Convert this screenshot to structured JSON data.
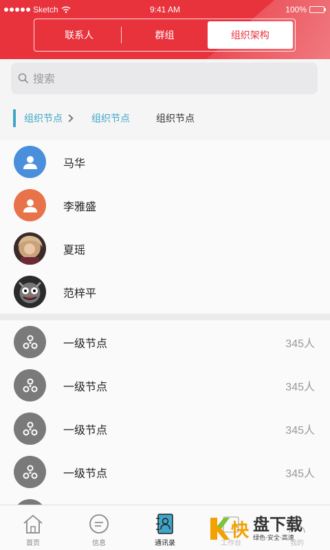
{
  "status_bar": {
    "carrier": "Sketch",
    "time": "9:41 AM",
    "battery": "100%"
  },
  "segments": [
    {
      "label": "联系人",
      "active": false
    },
    {
      "label": "群组",
      "active": false
    },
    {
      "label": "组织架构",
      "active": true
    }
  ],
  "search": {
    "placeholder": "搜索"
  },
  "breadcrumb": {
    "item1": "组织节点",
    "item2": "组织节点",
    "current": "组织节点"
  },
  "people": [
    {
      "name": "马华",
      "avatar": "person-icon",
      "color": "#4a8fdc"
    },
    {
      "name": "李雅盛",
      "avatar": "person-icon",
      "color": "#e8734a"
    },
    {
      "name": "夏瑶",
      "avatar": "photo"
    },
    {
      "name": "范梓平",
      "avatar": "photo"
    }
  ],
  "nodes": [
    {
      "name": "一级节点",
      "count": "345人"
    },
    {
      "name": "一级节点",
      "count": "345人"
    },
    {
      "name": "一级节点",
      "count": "345人"
    },
    {
      "name": "一级节点",
      "count": "345人"
    }
  ],
  "tabbar": [
    {
      "label": "首页",
      "icon": "home-icon"
    },
    {
      "label": "信息",
      "icon": "message-icon"
    },
    {
      "label": "通讯录",
      "icon": "contacts-icon",
      "active": true
    },
    {
      "label": "工作台",
      "icon": "workbench-icon"
    },
    {
      "label": "我的",
      "icon": "profile-icon"
    }
  ],
  "watermark": {
    "main": "盘下载",
    "sub": "绿色·安全·高速",
    "logo_char": "快"
  }
}
